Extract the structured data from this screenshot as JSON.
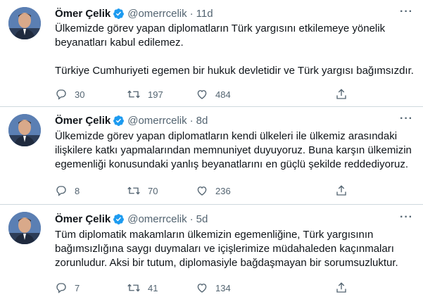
{
  "tweets": [
    {
      "name": "Ömer Çelik",
      "handle": "@omerrcelik",
      "separator": "·",
      "time": "11d",
      "paragraphs": [
        "Ülkemizde görev yapan diplomatların Türk yargısını etkilemeye yönelik beyanatları kabul edilemez.",
        "Türkiye Cumhuriyeti egemen bir hukuk devletidir ve Türk yargısı bağımsızdır."
      ],
      "replies": "30",
      "retweets": "197",
      "likes": "484"
    },
    {
      "name": "Ömer Çelik",
      "handle": "@omerrcelik",
      "separator": "·",
      "time": "8d",
      "paragraphs": [
        "Ülkemizde görev yapan diplomatların kendi ülkeleri ile ülkemiz arasındaki ilişkilere katkı yapmalarından memnuniyet duyuyoruz. Buna karşın ülkemizin egemenliği konusundaki yanlış beyanatlarını en güçlü şekilde reddediyoruz."
      ],
      "replies": "8",
      "retweets": "70",
      "likes": "236"
    },
    {
      "name": "Ömer Çelik",
      "handle": "@omerrcelik",
      "separator": "·",
      "time": "5d",
      "paragraphs": [
        "Tüm diplomatik makamların ülkemizin egemenliğine, Türk yargısının bağımsızlığına saygı duymaları ve içişlerimize müdahaleden kaçınmaları zorunludur. Aksi bir tutum, diplomasiyle bağdaşmayan bir sorumsuzluktur."
      ],
      "replies": "7",
      "retweets": "41",
      "likes": "134"
    }
  ],
  "icons": {
    "verified": "verified-badge-icon",
    "more": "more-options-icon",
    "reply": "reply-icon",
    "retweet": "retweet-icon",
    "like": "like-heart-icon",
    "share": "share-icon"
  },
  "colors": {
    "verified": "#1d9bf0",
    "secondary_text": "#536471",
    "divider": "#cfd9de"
  }
}
